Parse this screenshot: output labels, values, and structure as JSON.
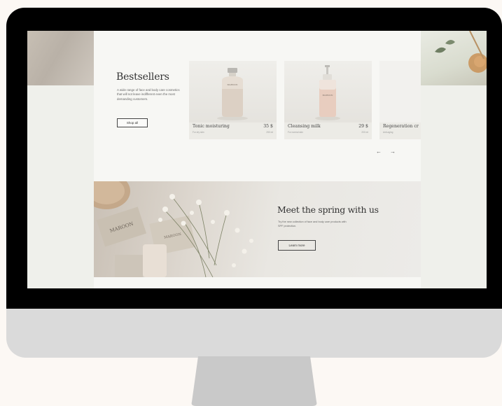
{
  "bestsellers": {
    "title": "Bestsellers",
    "description": "A wide range of face and body care cosmetics that will not leave indifferent even the most demanding customers.",
    "shop_all": "Shop all"
  },
  "products": [
    {
      "name": "Tonic moisturing",
      "price": "35 $",
      "sub": "For dry skin",
      "volume": "250 ml",
      "bottle_label": "MAROON"
    },
    {
      "name": "Cleansing milk",
      "price": "29 $",
      "sub": "For normal skin",
      "volume": "200 ml",
      "bottle_label": "MAROON"
    },
    {
      "name": "Regeneration cr",
      "price": "",
      "sub": "Anti-aging",
      "volume": "",
      "bottle_label": ""
    }
  ],
  "carousel": {
    "prev": "←",
    "next": "→"
  },
  "promo": {
    "title": "Meet the spring with us",
    "description": "Try the new collection of face and body care products with SPF protection.",
    "learn_more": "Learn more",
    "brand_card": "MAROON",
    "brand_card_2": "MAROON"
  },
  "colors": {
    "frame": "#000000",
    "chin": "#dadada",
    "stand": "#c8c8c8",
    "background": "#fcf8f4",
    "page": "#f7f7f4"
  }
}
